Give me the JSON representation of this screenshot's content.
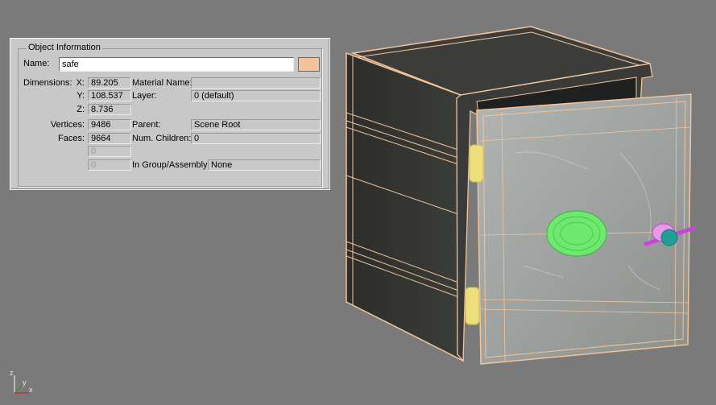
{
  "panel": {
    "group_title": "Object Information",
    "name_label": "Name:",
    "name_value": "safe",
    "object_color": "#f3c49a",
    "dimensions_label": "Dimensions:",
    "x_label": "X:",
    "x_value": "89.205",
    "y_label": "Y:",
    "y_value": "108.537",
    "z_label": "Z:",
    "z_value": "8.736",
    "vertices_label": "Vertices:",
    "vertices_value": "9486",
    "faces_label": "Faces:",
    "faces_value": "9664",
    "extra1_value": "0",
    "extra2_value": "0",
    "material_label": "Material Name:",
    "material_value": "",
    "layer_label": "Layer:",
    "layer_value": "0 (default)",
    "parent_label": "Parent:",
    "parent_value": "Scene Root",
    "children_label": "Num. Children:",
    "children_value": "0",
    "group_label": "In Group/Assembly:",
    "group_value": "None"
  },
  "viewport": {
    "background": "#7a7a7a",
    "wire_color": "#f3c49a",
    "axis_labels": {
      "x": "x",
      "y": "y",
      "z": "z"
    }
  }
}
